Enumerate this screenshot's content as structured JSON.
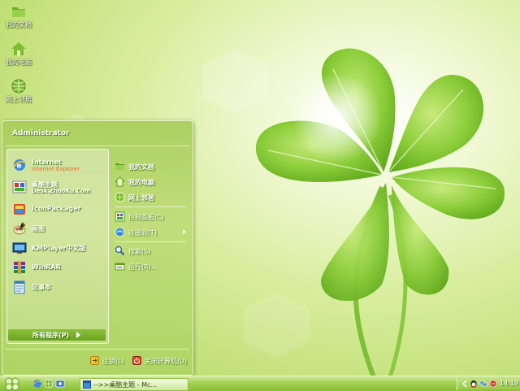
{
  "desktop": {
    "icons": [
      {
        "label": "我的文档",
        "icon": "folder-icon"
      },
      {
        "label": "我的电脑",
        "icon": "house-icon"
      },
      {
        "label": "网上邻居",
        "icon": "globe-icon"
      }
    ]
  },
  "start_menu": {
    "user_name": "Administrator",
    "programs": [
      {
        "title": "Internet",
        "subtitle": "Internet Explorer",
        "icon": "ie-icon"
      },
      {
        "title": "桌酷主题",
        "subtitle": "Desk.ZhuoKu.Com",
        "icon": "zhuoku-icon"
      },
      {
        "title": "IconPackager",
        "subtitle": "",
        "icon": "iconpackager-icon"
      },
      {
        "title": "画图",
        "subtitle": "",
        "icon": "paint-icon"
      },
      {
        "title": "KMPlayer中文版",
        "subtitle": "",
        "icon": "kmplayer-icon"
      },
      {
        "title": "WinRAR",
        "subtitle": "",
        "icon": "winrar-icon"
      },
      {
        "title": "记事本",
        "subtitle": "",
        "icon": "notepad-icon"
      }
    ],
    "all_programs_label": "所有程序(P)",
    "places": [
      {
        "label": "我的文档",
        "icon": "folder-icon"
      },
      {
        "label": "我的电脑",
        "icon": "house-icon"
      },
      {
        "label": "网上邻居",
        "icon": "globe-icon"
      }
    ],
    "system": [
      {
        "label": "控制面板(C)",
        "icon": "control-panel-icon"
      },
      {
        "label": "连接到(T)",
        "icon": "connect-icon"
      }
    ],
    "tools": [
      {
        "label": "搜索(S)",
        "icon": "search-icon"
      },
      {
        "label": "运行(R)...",
        "icon": "run-icon"
      }
    ],
    "logoff_label": "注销(L)",
    "shutdown_label": "关闭计算机(U)"
  },
  "taskbar": {
    "task_label": "-->>桌酷主题 - Mc...",
    "clock": "14:19"
  },
  "colors": {
    "accent": "#86bd32",
    "text_shadow": "#3b6a0a",
    "ie_subtitle": "#e26b2c"
  }
}
